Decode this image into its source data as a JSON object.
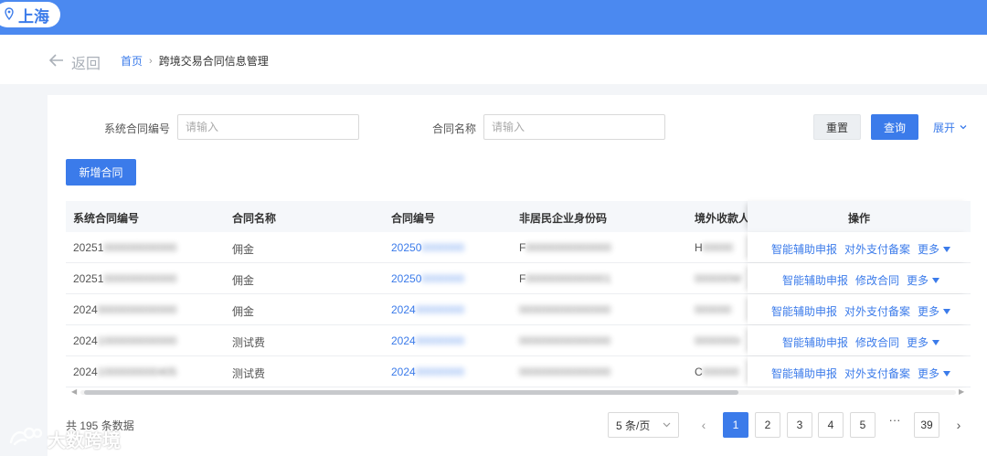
{
  "topbar": {
    "city": "上海",
    "accent_color": "#4b89f0"
  },
  "nav": {
    "back_label": "返回",
    "breadcrumb": {
      "home": "首页",
      "current": "跨境交易合同信息管理"
    }
  },
  "filters": {
    "contract_sys_no": {
      "label": "系统合同编号",
      "placeholder": "请输入"
    },
    "contract_name": {
      "label": "合同名称",
      "placeholder": "请输入"
    },
    "reset_label": "重置",
    "query_label": "查询",
    "expand_label": "展开"
  },
  "toolbar": {
    "add_label": "新增合同"
  },
  "table": {
    "columns": [
      "系统合同编号",
      "合同名称",
      "合同编号",
      "非居民企业身份码",
      "境外收款人",
      "操作"
    ],
    "rows": [
      {
        "sys_no": "20251",
        "sys_no_rest": "000000000000",
        "name": "佣金",
        "contract_no": "20250",
        "contract_no_rest": "0000000",
        "id_code": "F",
        "id_code_rest": "00000000000000",
        "payee": "H",
        "payee_rest": "00000",
        "ops": [
          "智能辅助申报",
          "对外支付备案"
        ],
        "more": "更多"
      },
      {
        "sys_no": "20251",
        "sys_no_rest": "000000000000",
        "name": "佣金",
        "contract_no": "20250",
        "contract_no_rest": "0000000",
        "id_code": "F",
        "id_code_rest": "00000000000001",
        "payee": "",
        "payee_rest": "000000W",
        "ops": [
          "智能辅助申报",
          "修改合同"
        ],
        "more": "更多"
      },
      {
        "sys_no": "2024",
        "sys_no_rest": "0000000000000",
        "name": "佣金",
        "contract_no": "2024",
        "contract_no_rest": "00000000",
        "id_code": "",
        "id_code_rest": "000000000000000",
        "payee": "",
        "payee_rest": "000000",
        "ops": [
          "智能辅助申报",
          "对外支付备案"
        ],
        "more": "更多"
      },
      {
        "sys_no": "2024",
        "sys_no_rest": "1000000000000",
        "name": "测试费",
        "contract_no": "2024",
        "contract_no_rest": "00000000",
        "id_code": "",
        "id_code_rest": "000000000000000",
        "payee": "",
        "payee_rest": "0000000r",
        "ops": [
          "智能辅助申报",
          "修改合同"
        ],
        "more": "更多"
      },
      {
        "sys_no": "2024",
        "sys_no_rest": "1000000000405",
        "name": "测试费",
        "contract_no": "2024",
        "contract_no_rest": "00000000",
        "id_code": "",
        "id_code_rest": "000000000000000",
        "payee": "C",
        "payee_rest": "000000",
        "ops": [
          "智能辅助申报",
          "对外支付备案"
        ],
        "more": "更多"
      }
    ]
  },
  "pagination": {
    "total_text": "共 195 条数据",
    "page_size": "5 条/页",
    "pages": [
      "1",
      "2",
      "3",
      "4",
      "5"
    ],
    "ellipsis": "···",
    "last_page": "39",
    "current_page": 1
  },
  "watermark": {
    "text": "大数跨境"
  }
}
